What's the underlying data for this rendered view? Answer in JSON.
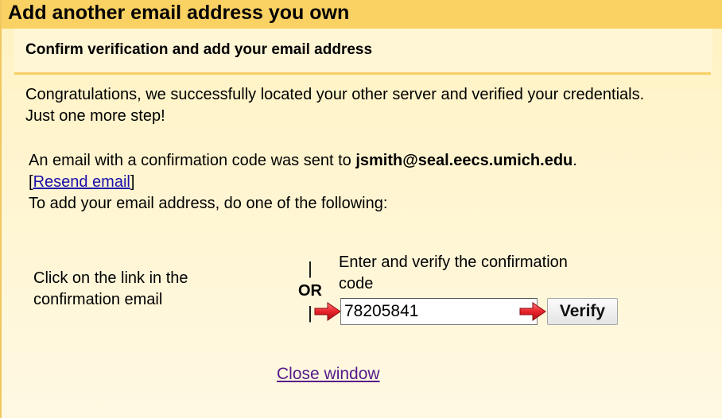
{
  "window": {
    "title": "Add another email address you own",
    "subtitle": "Confirm verification and add your email address"
  },
  "intro": {
    "line1": "Congratulations, we successfully located your other server and verified your credentials.",
    "line2": "Just one more step!"
  },
  "confirmation": {
    "sent_prefix": "An email with a confirmation code was sent to ",
    "email": "jsmith@seal.eecs.umich.edu",
    "sent_suffix": ".",
    "resend_open": "[",
    "resend_label": "Resend email",
    "resend_close": "]",
    "instruction": "To add your email address, do one of the following:"
  },
  "options": {
    "left_line1": "Click on the link in the",
    "left_line2": "confirmation email",
    "separator_bar": "|",
    "separator_label": "OR",
    "right_line1": "Enter and verify the confirmation",
    "right_line2": "code",
    "code_value": "78205841",
    "verify_label": "Verify"
  },
  "footer": {
    "close_label": "Close window"
  },
  "colors": {
    "title_bar": "#fad163",
    "background": "#fff4c9",
    "arrow": "#e8232a"
  },
  "icons": {
    "pointer_arrow": "red-right-arrow-icon"
  }
}
